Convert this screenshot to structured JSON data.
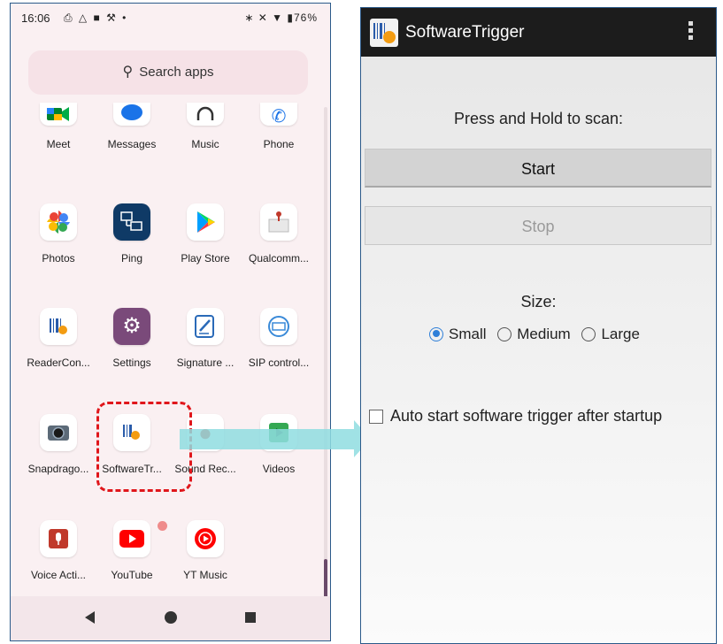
{
  "status_bar": {
    "time": "16:06",
    "battery": "76%"
  },
  "search": {
    "placeholder": "Search apps"
  },
  "apps": [
    {
      "label": "Meet"
    },
    {
      "label": "Messages"
    },
    {
      "label": "Music"
    },
    {
      "label": "Phone"
    },
    {
      "label": "Photos"
    },
    {
      "label": "Ping"
    },
    {
      "label": "Play Store"
    },
    {
      "label": "Qualcomm..."
    },
    {
      "label": "ReaderCon..."
    },
    {
      "label": "Settings"
    },
    {
      "label": "Signature ..."
    },
    {
      "label": "SIP control..."
    },
    {
      "label": "Snapdrago..."
    },
    {
      "label": "SoftwareTr..."
    },
    {
      "label": "Sound Rec..."
    },
    {
      "label": "Videos"
    },
    {
      "label": "Voice Acti..."
    },
    {
      "label": "YouTube"
    },
    {
      "label": "YT Music"
    }
  ],
  "software_trigger": {
    "title": "SoftwareTrigger",
    "instruction": "Press and Hold to scan:",
    "start_label": "Start",
    "stop_label": "Stop",
    "size_label": "Size:",
    "size_options": [
      "Small",
      "Medium",
      "Large"
    ],
    "selected_size": "Small",
    "auto_start_label": "Auto start software trigger after startup",
    "auto_start_checked": false
  },
  "colors": {
    "highlight": "#e0161b",
    "arrow": "#8fdde0",
    "radio_selected": "#2f7fd8",
    "app_bar": "#1c1c1c"
  }
}
